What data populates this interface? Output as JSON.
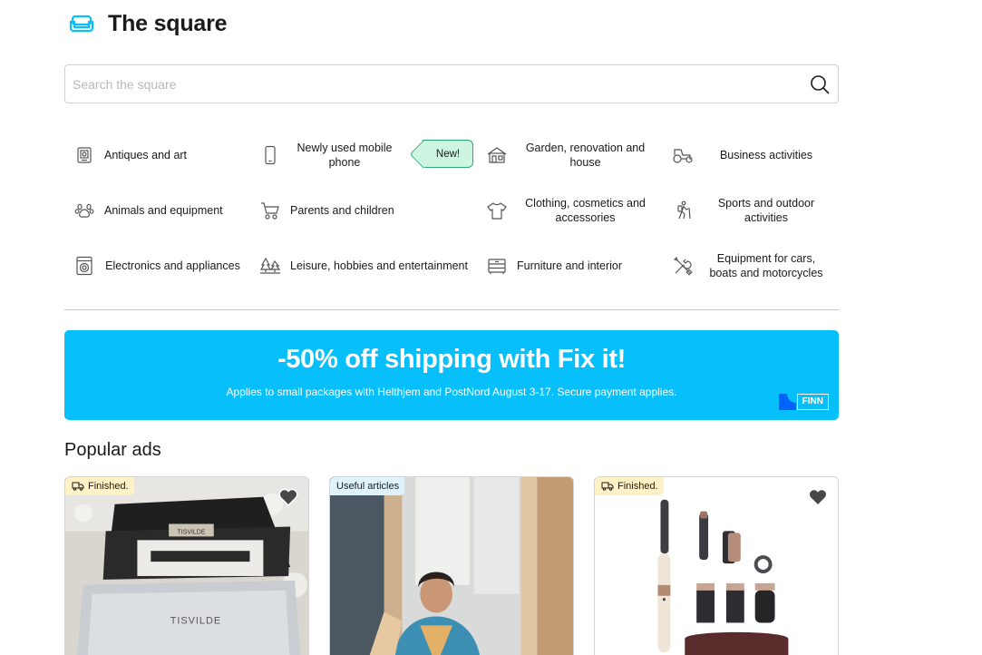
{
  "header": {
    "title": "The square",
    "logo_icon": "sofa-icon",
    "logo_color": "#06bffb"
  },
  "search": {
    "placeholder": "Search the square",
    "value": "",
    "button_icon": "search-icon"
  },
  "categories": [
    {
      "label": "Antiques and art",
      "icon": "antique-frame-icon"
    },
    {
      "label": "Newly used mobile phone",
      "icon": "mobile-phone-icon",
      "badge": "New!"
    },
    {
      "label": "Garden, renovation and house",
      "icon": "house-icon"
    },
    {
      "label": "Business activities",
      "icon": "tractor-icon"
    },
    {
      "label": "Animals and equipment",
      "icon": "paw-icon"
    },
    {
      "label": "Parents and children",
      "icon": "stroller-icon"
    },
    {
      "label": "Clothing, cosmetics and accessories",
      "icon": "tshirt-icon"
    },
    {
      "label": "Sports and outdoor activities",
      "icon": "hiker-icon"
    },
    {
      "label": "Electronics and appliances",
      "icon": "washing-machine-icon"
    },
    {
      "label": "Leisure, hobbies and entertainment",
      "icon": "trees-icon"
    },
    {
      "label": "Furniture and interior",
      "icon": "dresser-icon"
    },
    {
      "label": "Equipment for cars, boats and motorcycles",
      "icon": "tools-icon"
    }
  ],
  "banner": {
    "title": "-50% off shipping with Fix it!",
    "subtitle": "Applies to small packages with Helthjem and PostNord August 3-17. Secure payment applies.",
    "brand": "FINN",
    "background_color": "#06bffb",
    "brand_color": "#0063fb"
  },
  "popular": {
    "title": "Popular ads",
    "ads": [
      {
        "tag": "Finished.",
        "tag_icon": "delivery-truck-icon",
        "tag_style": "yellow",
        "favorite_icon": "heart-icon",
        "photo_icon": "tisvilde-box-photo",
        "photo_text": "TISVILDE"
      },
      {
        "tag": "Useful articles",
        "tag_style": "blue",
        "photo_icon": "person-in-mirror-photo"
      },
      {
        "tag": "Finished.",
        "tag_icon": "delivery-truck-icon",
        "tag_style": "yellow",
        "favorite_icon": "heart-icon",
        "photo_icon": "hair-styler-set-photo"
      }
    ]
  }
}
